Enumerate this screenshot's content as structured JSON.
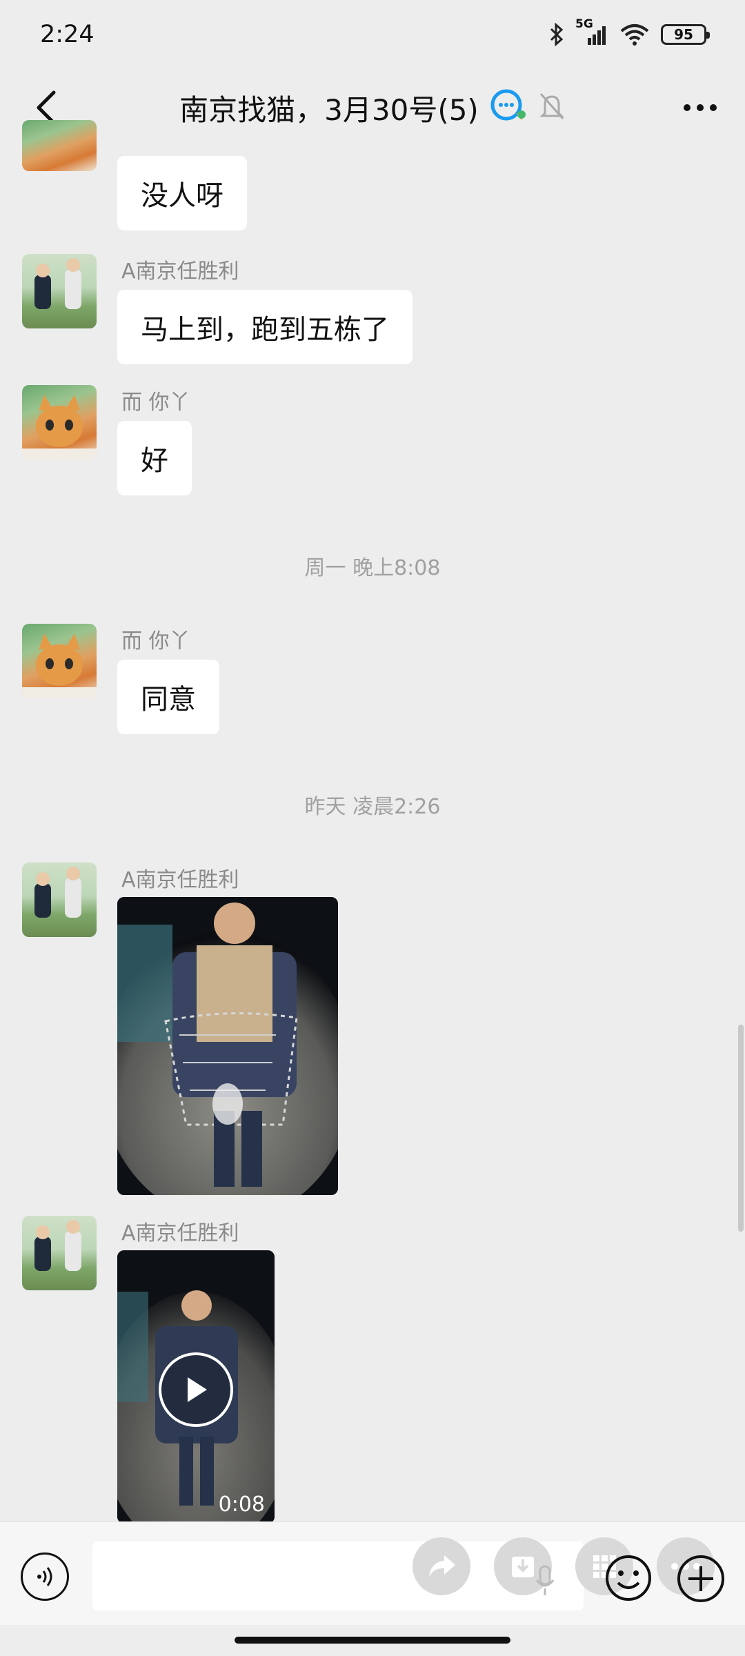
{
  "status_bar": {
    "time": "2:24",
    "network": "5G",
    "battery": "95"
  },
  "header": {
    "title": "南京找猫，3月30号(5)",
    "icons": [
      "back-arrow-icon",
      "group-chat-icon",
      "mute-bell-icon",
      "more-icon"
    ]
  },
  "messages": [
    {
      "sender": "",
      "avatar": "cat",
      "text": "没人呀"
    },
    {
      "sender": "A南京任胜利",
      "avatar": "kids",
      "text": "马上到，跑到五栋了"
    },
    {
      "sender": "而 你丫",
      "avatar": "cat",
      "text": "好"
    },
    {
      "timestamp": "周一 晚上8:08"
    },
    {
      "sender": "而 你丫",
      "avatar": "cat",
      "text": "同意"
    },
    {
      "timestamp": "昨天 凌晨2:26"
    },
    {
      "sender": "A南京任胜利",
      "avatar": "kids",
      "type": "image"
    },
    {
      "sender": "A南京任胜利",
      "avatar": "kids",
      "type": "video",
      "duration": "0:08"
    }
  ],
  "input_bar": {
    "text_value": "",
    "icons": [
      "voice-icon",
      "forward-icon",
      "save-icon",
      "grid-icon",
      "emoji-icon",
      "more-icon",
      "plus-icon"
    ]
  },
  "colors": {
    "background": "#ededed",
    "bubble": "#ffffff",
    "accent_blue": "#1a9bf0"
  }
}
